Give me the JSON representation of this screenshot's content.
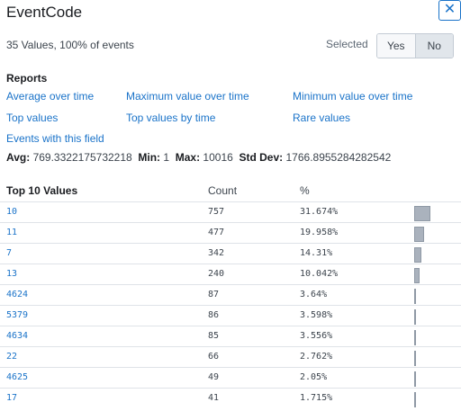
{
  "header": {
    "title": "EventCode",
    "close_glyph": "✕"
  },
  "summary": "35 Values, 100% of events",
  "selected": {
    "label": "Selected",
    "yes": "Yes",
    "no": "No",
    "active": "No"
  },
  "reports": {
    "heading": "Reports",
    "links": {
      "avg_over_time": "Average over time",
      "max_over_time": "Maximum value over time",
      "min_over_time": "Minimum value over time",
      "top_values": "Top values",
      "top_values_by_time": "Top values by time",
      "rare_values": "Rare values",
      "events_with_field": "Events with this field"
    }
  },
  "stats": {
    "avg_label": "Avg:",
    "avg": "769.3322175732218",
    "min_label": "Min:",
    "min": "1",
    "max_label": "Max:",
    "max": "10016",
    "std_label": "Std Dev:",
    "std": "1766.8955284282542"
  },
  "table": {
    "headers": {
      "value": "Top 10 Values",
      "count": "Count",
      "percent": "%"
    },
    "rows": [
      {
        "value": "10",
        "count": "757",
        "percent": "31.674%",
        "fraction": 0.31674
      },
      {
        "value": "11",
        "count": "477",
        "percent": "19.958%",
        "fraction": 0.19958
      },
      {
        "value": "7",
        "count": "342",
        "percent": "14.31%",
        "fraction": 0.1431
      },
      {
        "value": "13",
        "count": "240",
        "percent": "10.042%",
        "fraction": 0.10042
      },
      {
        "value": "4624",
        "count": "87",
        "percent": "3.64%",
        "fraction": 0.0364
      },
      {
        "value": "5379",
        "count": "86",
        "percent": "3.598%",
        "fraction": 0.03598
      },
      {
        "value": "4634",
        "count": "85",
        "percent": "3.556%",
        "fraction": 0.03556
      },
      {
        "value": "22",
        "count": "66",
        "percent": "2.762%",
        "fraction": 0.02762
      },
      {
        "value": "4625",
        "count": "49",
        "percent": "2.05%",
        "fraction": 0.0205
      },
      {
        "value": "17",
        "count": "41",
        "percent": "1.715%",
        "fraction": 0.01715
      }
    ]
  }
}
